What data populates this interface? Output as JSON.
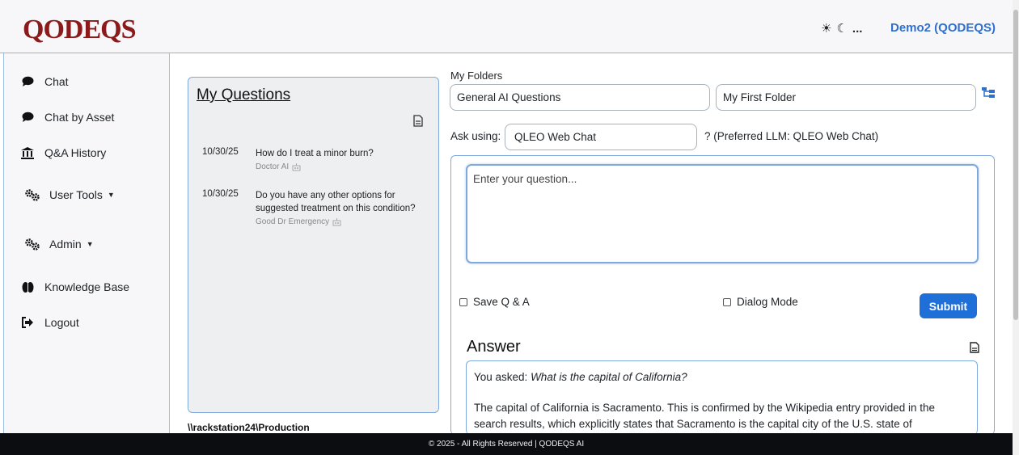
{
  "header": {
    "logo_text": "QODEQS",
    "theme_sun": "☀",
    "theme_moon": "☾",
    "theme_more": "...",
    "user_label": "Demo2 (QODEQS)"
  },
  "sidebar": {
    "items": [
      {
        "label": "Chat",
        "icon": "chat-bubble-icon"
      },
      {
        "label": "Chat by Asset",
        "icon": "chat-bubble-icon"
      },
      {
        "label": "Q&A History",
        "icon": "bank-icon"
      },
      {
        "label": "User Tools",
        "icon": "gears-icon"
      },
      {
        "label": "Admin",
        "icon": "gears-icon"
      },
      {
        "label": "Knowledge Base",
        "icon": "brain-icon"
      },
      {
        "label": "Logout",
        "icon": "logout-icon"
      }
    ]
  },
  "questions": {
    "title": "My Questions",
    "items": [
      {
        "date": "10/30/25",
        "text": "How do I treat a minor burn?",
        "author": "Doctor AI"
      },
      {
        "date": "10/30/25",
        "text": "Do you have any other options for suggested treatment on this condition?",
        "author": "Good Dr Emergency"
      }
    ],
    "path": "\\\\rackstation24\\Production"
  },
  "folders": {
    "label": "My Folders",
    "folder1": "General AI Questions",
    "folder2": "My First Folder"
  },
  "ask": {
    "label": "Ask using:",
    "model": "QLEO Web Chat",
    "preferred_note": "? (Preferred LLM: QLEO Web Chat)",
    "placeholder": "Enter your question...",
    "save_label": "Save Q & A",
    "dialog_label": "Dialog Mode",
    "submit_label": "Submit"
  },
  "answer": {
    "title": "Answer",
    "asked_prefix": "You asked: ",
    "asked_question": "What is the capital of California?",
    "text": "The capital of California is Sacramento. This is confirmed by the Wikipedia entry provided in the search results, which explicitly states that Sacramento is the capital city of the U.S. state of"
  },
  "footer": {
    "text": "© 2025 - All Rights Reserved | QODEQS AI"
  }
}
